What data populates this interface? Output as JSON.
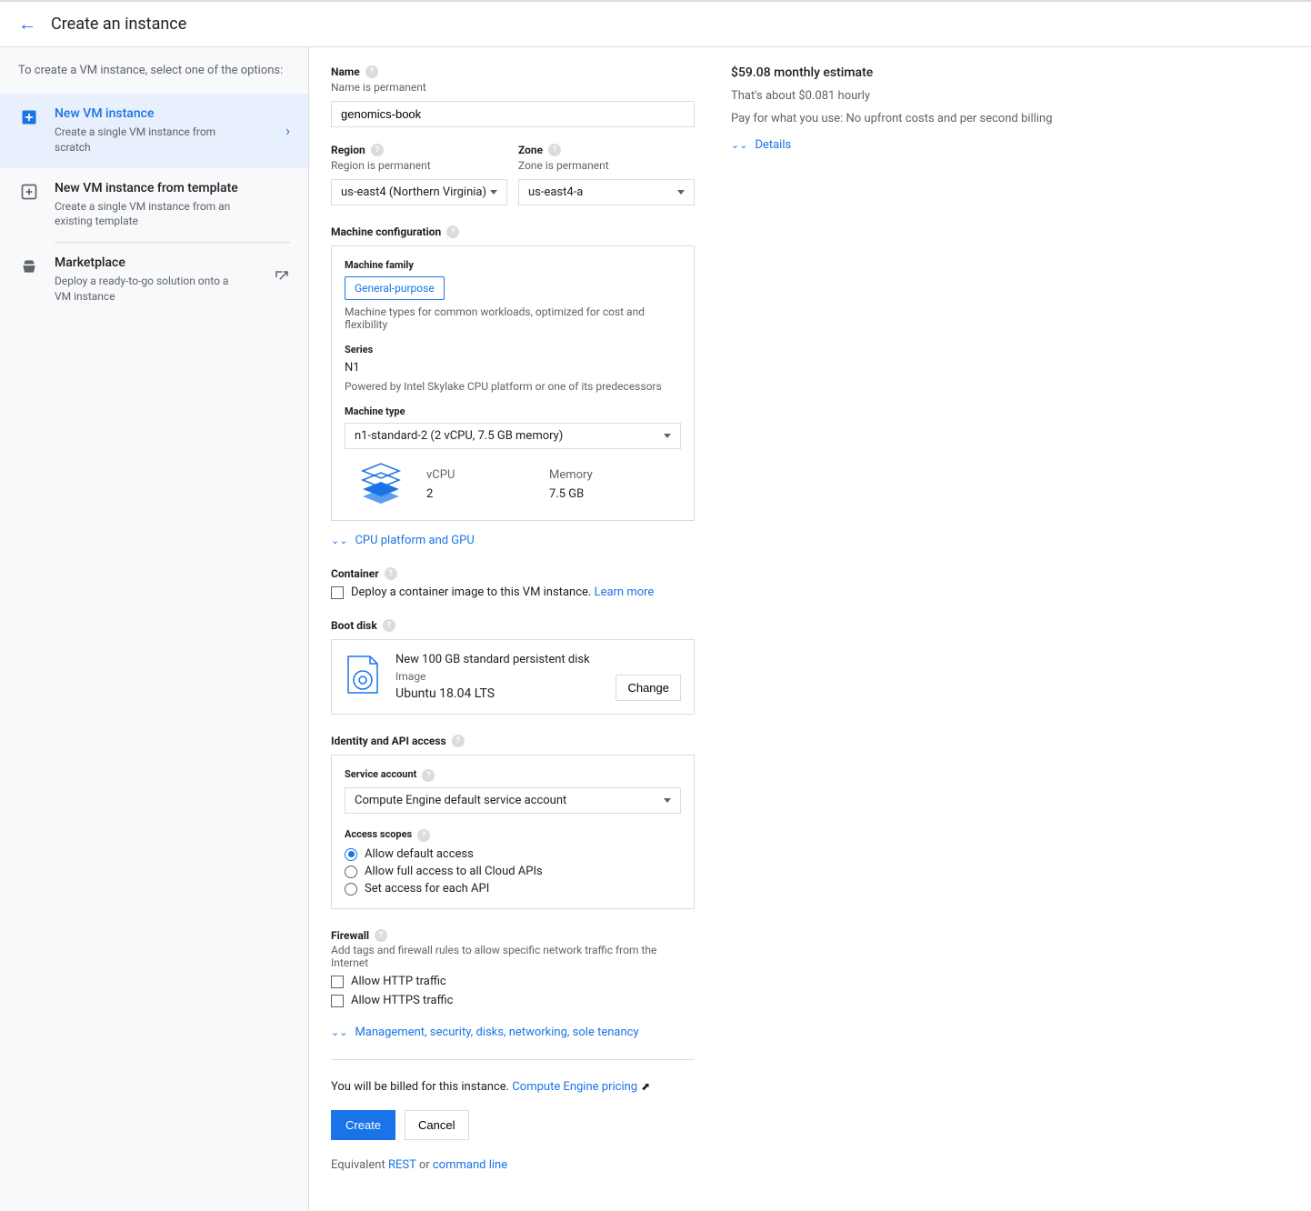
{
  "header": {
    "title": "Create an instance"
  },
  "sidebar": {
    "intro": "To create a VM instance, select one of the options:",
    "items": [
      {
        "title": "New VM instance",
        "desc": "Create a single VM instance from scratch"
      },
      {
        "title": "New VM instance from template",
        "desc": "Create a single VM instance from an existing template"
      },
      {
        "title": "Marketplace",
        "desc": "Deploy a ready-to-go solution onto a VM instance"
      }
    ]
  },
  "form": {
    "name": {
      "label": "Name",
      "hint": "Name is permanent",
      "value": "genomics-book"
    },
    "region": {
      "label": "Region",
      "hint": "Region is permanent",
      "value": "us-east4 (Northern Virginia)"
    },
    "zone": {
      "label": "Zone",
      "hint": "Zone is permanent",
      "value": "us-east4-a"
    },
    "machine_config": {
      "label": "Machine configuration",
      "family_label": "Machine family",
      "family_value": "General-purpose",
      "family_hint": "Machine types for common workloads, optimized for cost and flexibility",
      "series_label": "Series",
      "series_value": "N1",
      "series_hint": "Powered by Intel Skylake CPU platform or one of its predecessors",
      "type_label": "Machine type",
      "type_value": "n1-standard-2 (2 vCPU, 7.5 GB memory)",
      "vcpu_label": "vCPU",
      "vcpu_value": "2",
      "memory_label": "Memory",
      "memory_value": "7.5 GB",
      "cpu_gpu_link": "CPU platform and GPU"
    },
    "container": {
      "label": "Container",
      "checkbox_text": "Deploy a container image to this VM instance.",
      "learn_more": "Learn more"
    },
    "boot_disk": {
      "label": "Boot disk",
      "title": "New 100 GB standard persistent disk",
      "image_label": "Image",
      "os": "Ubuntu 18.04 LTS",
      "change": "Change"
    },
    "identity": {
      "label": "Identity and API access",
      "service_account_label": "Service account",
      "service_account_value": "Compute Engine default service account",
      "scopes_label": "Access scopes",
      "scopes": [
        "Allow default access",
        "Allow full access to all Cloud APIs",
        "Set access for each API"
      ]
    },
    "firewall": {
      "label": "Firewall",
      "hint": "Add tags and firewall rules to allow specific network traffic from the Internet",
      "http": "Allow HTTP traffic",
      "https": "Allow HTTPS traffic"
    },
    "mgmt_link": "Management, security, disks, networking, sole tenancy",
    "billing_text": "You will be billed for this instance.",
    "pricing_link": "Compute Engine pricing",
    "create": "Create",
    "cancel": "Cancel",
    "equivalent_prefix": "Equivalent ",
    "rest": "REST",
    "or": " or ",
    "cmdline": "command line"
  },
  "estimate": {
    "title": "$59.08 monthly estimate",
    "hourly": "That's about $0.081 hourly",
    "payg": "Pay for what you use: No upfront costs and per second billing",
    "details": "Details"
  }
}
